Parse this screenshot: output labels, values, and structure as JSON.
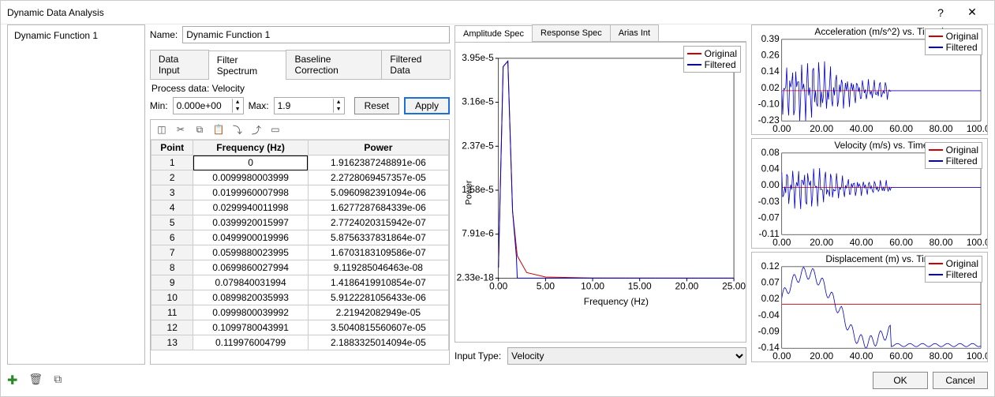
{
  "window": {
    "title": "Dynamic Data Analysis"
  },
  "list": {
    "items": [
      "Dynamic Function 1"
    ]
  },
  "form": {
    "name_label": "Name:",
    "name_value": "Dynamic Function 1",
    "tabs": [
      "Data Input",
      "Filter Spectrum",
      "Baseline Correction",
      "Filtered Data"
    ],
    "active_tab": 1,
    "process_label": "Process data: Velocity",
    "min_label": "Min:",
    "min_value": "0.000e+00",
    "max_label": "Max:",
    "max_value": "1.9",
    "reset_label": "Reset",
    "apply_label": "Apply"
  },
  "table": {
    "headers": [
      "Point",
      "Frequency (Hz)",
      "Power"
    ],
    "rows": [
      [
        "1",
        "0",
        "1.9162387248891e-06"
      ],
      [
        "2",
        "0.0099980003999",
        "2.2728069457357e-05"
      ],
      [
        "3",
        "0.0199960007998",
        "5.0960982391094e-06"
      ],
      [
        "4",
        "0.0299940011998",
        "1.6277287684339e-06"
      ],
      [
        "5",
        "0.0399920015997",
        "2.7724020315942e-07"
      ],
      [
        "6",
        "0.0499900019996",
        "5.8756337831864e-07"
      ],
      [
        "7",
        "0.0599880023995",
        "1.6703183109586e-07"
      ],
      [
        "8",
        "0.0699860027994",
        "9.119285046463e-08"
      ],
      [
        "9",
        "0.079840031994",
        "1.4186419910854e-07"
      ],
      [
        "10",
        "0.0899820035993",
        "5.9122281056433e-06"
      ],
      [
        "11",
        "0.0999800039992",
        "2.21942082949e-05"
      ],
      [
        "12",
        "0.1099780043991",
        "3.5040815560607e-05"
      ],
      [
        "13",
        "0.119976004799",
        "2.1883325014094e-05"
      ]
    ]
  },
  "spec": {
    "tabs": [
      "Amplitude Spec",
      "Response Spec",
      "Arias Int"
    ],
    "active_tab": 0,
    "legend": [
      "Original",
      "Filtered"
    ],
    "input_type_label": "Input Type:",
    "input_type_value": "Velocity",
    "xlabel": "Frequency (Hz)",
    "ylabel": "Power"
  },
  "mini": {
    "legend": [
      "Original",
      "Filtered"
    ],
    "charts": [
      {
        "title": "Acceleration (m/s^2) vs. Time (s",
        "yticks": [
          "0.39",
          "0.26",
          "0.14",
          "0.02",
          "-0.10",
          "-0.23"
        ],
        "xticks": [
          "0.00",
          "20.00",
          "40.00",
          "60.00",
          "80.00",
          "100.00"
        ]
      },
      {
        "title": "Velocity (m/s) vs. Time",
        "yticks": [
          "0.08",
          "0.04",
          "0.00",
          "-0.03",
          "-0.07",
          "-0.11"
        ],
        "xticks": [
          "0.00",
          "20.00",
          "40.00",
          "60.00",
          "80.00",
          "100.00"
        ]
      },
      {
        "title": "Displacement (m) vs. Time",
        "yticks": [
          "0.12",
          "0.07",
          "0.02",
          "-0.04",
          "-0.09",
          "-0.14"
        ],
        "xticks": [
          "0.00",
          "20.00",
          "40.00",
          "60.00",
          "80.00",
          "100.00"
        ]
      }
    ]
  },
  "footer": {
    "ok": "OK",
    "cancel": "Cancel"
  },
  "icons": {
    "add": "add-icon",
    "delete": "trash-icon",
    "copy": "copy-icon"
  },
  "colors": {
    "original": "#d00000",
    "filtered": "#0000d0"
  },
  "chart_data": {
    "type": "line",
    "title": "",
    "xlabel": "Frequency (Hz)",
    "ylabel": "Power",
    "xlim": [
      0,
      25
    ],
    "ylim": [
      2.33e-18,
      3.95e-05
    ],
    "xticks": [
      0.0,
      5.0,
      10.0,
      15.0,
      20.0,
      25.0
    ],
    "yticks": [
      "3.95e-5",
      "3.16e-5",
      "2.37e-5",
      "1.58e-5",
      "7.91e-6",
      "2.33e-18"
    ],
    "series": [
      {
        "name": "Original",
        "color": "#d00000",
        "x": [
          0,
          0.5,
          1,
          1.5,
          2,
          3,
          5,
          10,
          20,
          25
        ],
        "values": [
          1.9e-06,
          3.8e-05,
          3.9e-05,
          1.2e-05,
          4e-06,
          1e-06,
          2e-07,
          1e-08,
          5e-10,
          2.3e-18
        ]
      },
      {
        "name": "Filtered",
        "color": "#0000d0",
        "x": [
          0,
          0.5,
          1,
          1.5,
          1.9,
          2,
          3,
          5,
          10,
          20,
          25
        ],
        "values": [
          1.9e-06,
          3.8e-05,
          3.9e-05,
          1.2e-05,
          4e-06,
          0,
          0,
          0,
          0,
          0,
          0
        ]
      }
    ]
  }
}
